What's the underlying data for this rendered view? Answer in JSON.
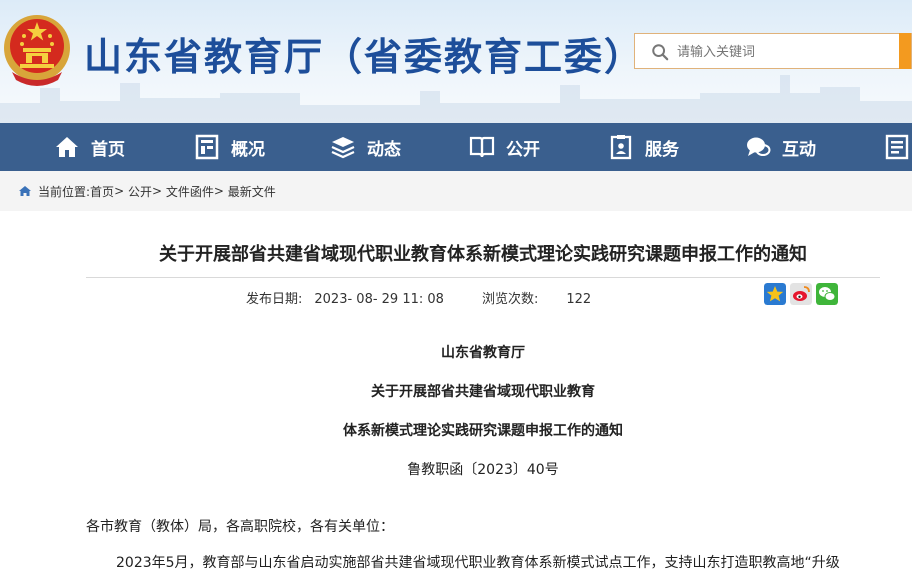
{
  "header": {
    "site_title": "山东省教育厅（省委教育工委）",
    "search_placeholder": "请输入关键词",
    "colors": {
      "nav_bg": "#3a5f8e",
      "title": "#1d4e9a",
      "search_button": "#f39a1f"
    }
  },
  "nav": {
    "items": [
      {
        "label": "首页",
        "icon": "home-icon"
      },
      {
        "label": "概况",
        "icon": "building-icon"
      },
      {
        "label": "动态",
        "icon": "layers-icon"
      },
      {
        "label": "公开",
        "icon": "book-icon"
      },
      {
        "label": "服务",
        "icon": "clipboard-icon"
      },
      {
        "label": "互动",
        "icon": "chat-icon"
      },
      {
        "label": "",
        "icon": "document-icon"
      }
    ]
  },
  "breadcrumb": {
    "prefix": "当前位置:",
    "items": [
      "首页",
      "公开",
      "文件函件",
      "最新文件"
    ],
    "separator": ">"
  },
  "article": {
    "title": "关于开展部省共建省域现代职业教育体系新模式理论实践研究课题申报工作的通知",
    "publish_label": "发布日期:",
    "publish_date": "2023- 08- 29 11: 08",
    "views_label": "浏览次数:",
    "views": "122",
    "share_icons": [
      "favorite-star-icon",
      "weibo-icon",
      "wechat-icon"
    ],
    "issuer": "山东省教育厅",
    "heading_line1": "关于开展部省共建省域现代职业教育",
    "heading_line2": "体系新模式理论实践研究课题申报工作的通知",
    "doc_number": "鲁教职函〔2023〕40号",
    "salutation": "各市教育（教体）局，各高职院校，各有关单位：",
    "first_paragraph": "2023年5月，教育部与山东省启动实施部省共建省域现代职业教育体系新模式试点工作，支持山东打造职教高地“升级"
  }
}
